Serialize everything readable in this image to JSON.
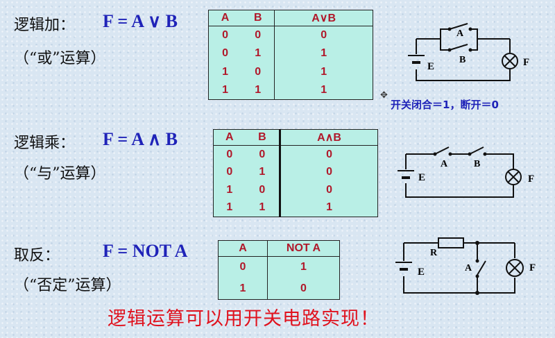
{
  "or_section": {
    "title": "逻辑加：",
    "formula": "F = A ∨ B",
    "subtitle": "（“或”运算）",
    "headers": [
      "A",
      "B",
      "A∨B"
    ],
    "rows": [
      [
        "0",
        "0",
        "0"
      ],
      [
        "0",
        "1",
        "1"
      ],
      [
        "1",
        "0",
        "1"
      ],
      [
        "1",
        "1",
        "1"
      ]
    ],
    "circuit_labels": {
      "a": "A",
      "b": "B",
      "e": "E",
      "f": "F"
    }
  },
  "and_section": {
    "title": "逻辑乘：",
    "formula": "F = A ∧ B",
    "subtitle": "（“与”运算）",
    "headers": [
      "A",
      "B",
      "A∧B"
    ],
    "rows": [
      [
        "0",
        "0",
        "0"
      ],
      [
        "0",
        "1",
        "0"
      ],
      [
        "1",
        "0",
        "0"
      ],
      [
        "1",
        "1",
        "1"
      ]
    ],
    "circuit_labels": {
      "a": "A",
      "b": "B",
      "e": "E",
      "f": "F"
    }
  },
  "not_section": {
    "title": "取反：",
    "formula": "F =  NOT  A",
    "subtitle": "（“否定”运算）",
    "headers": [
      "A",
      "NOT A"
    ],
    "rows": [
      [
        "0",
        "1"
      ],
      [
        "1",
        "0"
      ]
    ],
    "circuit_labels": {
      "r": "R",
      "a": "A",
      "e": "E",
      "f": "F"
    }
  },
  "switch_note": "开关闭合＝1，断开＝0",
  "banner": "逻辑运算可以用开关电路实现！",
  "colors": {
    "formula": "#1f23b8",
    "table_bg": "#b9efe6",
    "table_text": "#b0182a",
    "banner": "#e0121e"
  }
}
